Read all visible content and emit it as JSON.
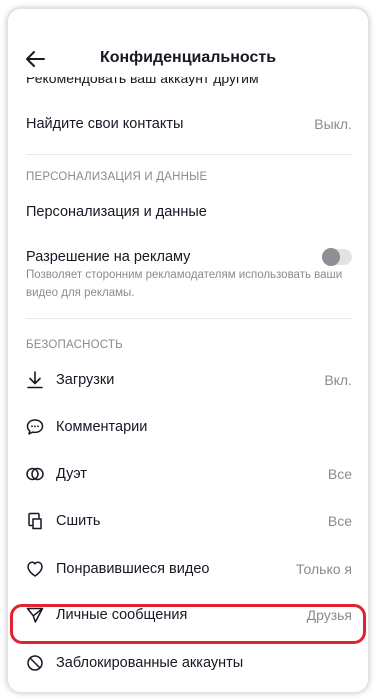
{
  "header": {
    "title": "Конфиденциальность"
  },
  "cut_row_label": "Рекомендовать ваш аккаунт другим",
  "contacts": {
    "label": "Найдите свои контакты",
    "value": "Выкл."
  },
  "personalization": {
    "section_title": "ПЕРСОНАЛИЗАЦИЯ И ДАННЫЕ",
    "item_label": "Персонализация и данные",
    "ads": {
      "label": "Разрешение на рекламу",
      "description": "Позволяет сторонним рекламодателям использовать ваши видео для рекламы.",
      "enabled": false
    }
  },
  "safety": {
    "section_title": "БЕЗОПАСНОСТЬ",
    "items": [
      {
        "label": "Загрузки",
        "value": "Вкл.",
        "icon": "download-icon"
      },
      {
        "label": "Комментарии",
        "value": "",
        "icon": "comment-icon"
      },
      {
        "label": "Дуэт",
        "value": "Все",
        "icon": "duet-icon"
      },
      {
        "label": "Сшить",
        "value": "Все",
        "icon": "stitch-icon"
      },
      {
        "label": "Понравившиеся видео",
        "value": "Только я",
        "icon": "heart-icon"
      },
      {
        "label": "Личные сообщения",
        "value": "Друзья",
        "icon": "send-icon"
      },
      {
        "label": "Заблокированные аккаунты",
        "value": "",
        "icon": "block-icon"
      }
    ]
  },
  "colors": {
    "text": "#161823",
    "secondary": "#8a8b91",
    "highlight": "#e0232f"
  }
}
